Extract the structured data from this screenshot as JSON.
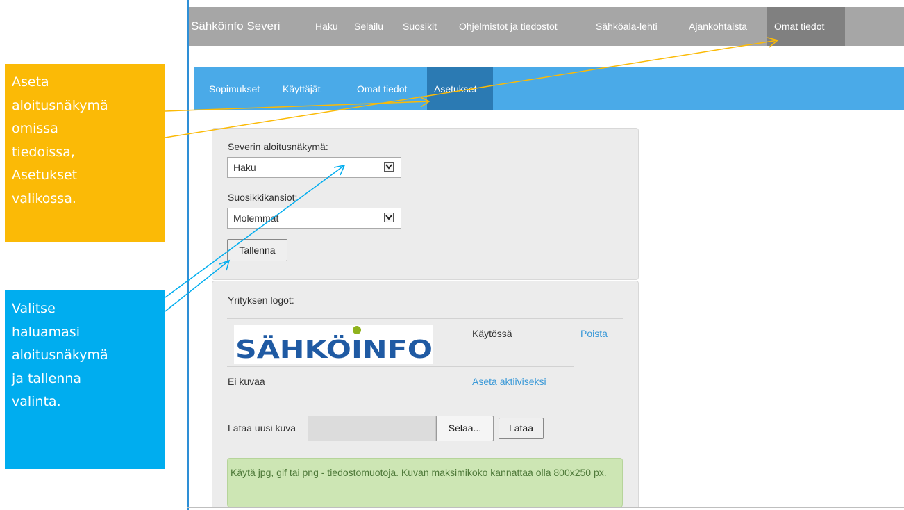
{
  "topnav": {
    "brand": "Sähköinfo Severi",
    "items": [
      "Haku",
      "Selailu",
      "Suosikit",
      "Ohjelmistot ja tiedostot",
      "Sähköala-lehti",
      "Ajankohtaista",
      "Omat tiedot"
    ],
    "active": "Omat tiedot"
  },
  "subnav": {
    "items": [
      "Sopimukset",
      "Käyttäjät",
      "Omat tiedot",
      "Asetukset"
    ],
    "active": "Asetukset"
  },
  "settings": {
    "start_view_label": "Severin aloitusnäkymä:",
    "start_view_value": "Haku",
    "favorites_label": "Suosikkikansiot:",
    "favorites_value": "Molemmat",
    "save_label": "Tallenna"
  },
  "logos": {
    "heading": "Yrityksen logot:",
    "rows": [
      {
        "image_text": "SÄHKÖINFO",
        "status": "Käytössä",
        "action": "Poista"
      },
      {
        "image_text": "Ei kuvaa",
        "status": "",
        "action": "Aseta aktiiviseksi"
      }
    ],
    "upload_label": "Lataa uusi kuva",
    "browse_label": "Selaa...",
    "upload_button": "Lataa",
    "hint": "Käytä jpg, gif tai png - tiedostomuotoja. Kuvan maksimikoko kannattaa olla 800x250 px."
  },
  "callouts": {
    "yellow": [
      "Aseta",
      "aloitusnäkymä",
      "omissa",
      "tiedoissa,",
      "Asetukset",
      "valikossa."
    ],
    "blue": [
      "Valitse",
      "haluamasi",
      "aloitusnäkymä",
      "ja tallenna",
      "valinta."
    ]
  },
  "colors": {
    "topnav": "#a6a6a6",
    "topnav_active": "#808080",
    "subnav": "#4aaae8",
    "subnav_active": "#2b7ab3",
    "callout_yellow": "#fbba06",
    "callout_blue": "#00adef",
    "link": "#3a99d8",
    "hint_bg": "#cde6b4"
  }
}
